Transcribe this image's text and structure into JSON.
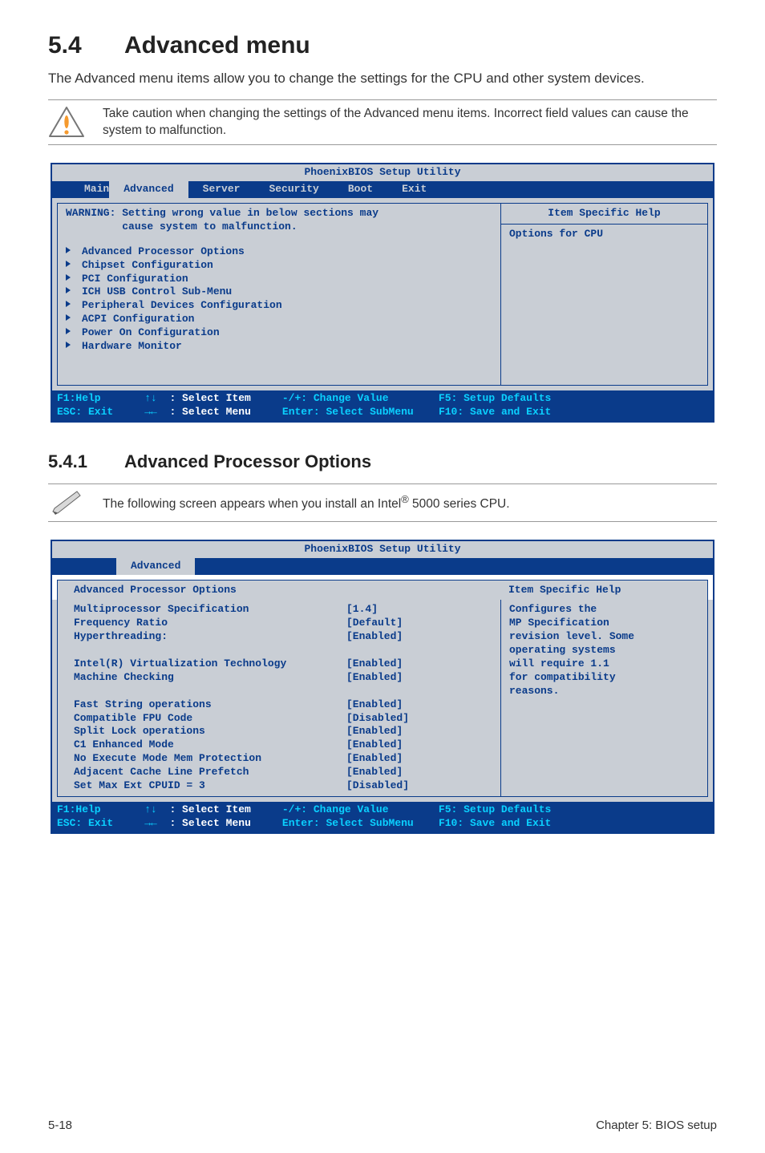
{
  "heading": {
    "num": "5.4",
    "title": "Advanced menu"
  },
  "intro": "The Advanced menu items allow you to change the settings for the CPU and other system devices.",
  "caution": "Take caution when changing the settings of the Advanced menu items. Incorrect field values can cause the system to malfunction.",
  "subheading": {
    "num": "5.4.1",
    "title": "Advanced Processor Options"
  },
  "note": {
    "pre": "The following screen appears when you install an Intel",
    "sup": "®",
    "post": " 5000 series CPU."
  },
  "bios1": {
    "utility_title": "PhoenixBIOS Setup Utility",
    "tabs": [
      "Main",
      "Advanced",
      "Server",
      "Security",
      "Boot",
      "Exit"
    ],
    "active_tab": "Advanced",
    "warning_l1": "WARNING: Setting wrong value in below sections may",
    "warning_l2": "         cause system to malfunction.",
    "menu": [
      "Advanced Processor Options",
      "Chipset Configuration",
      "PCI Configuration",
      "ICH USB Control Sub-Menu",
      "Peripheral Devices Configuration",
      "ACPI Configuration",
      "Power On Configuration",
      "Hardware Monitor"
    ],
    "help_title": "Item Specific Help",
    "help_body": "Options for CPU"
  },
  "bios2": {
    "utility_title": "PhoenixBIOS Setup Utility",
    "tab": "Advanced",
    "panel_title": "Advanced Processor Options",
    "settings": [
      {
        "label": "Multiprocessor Specification",
        "value": "[1.4]"
      },
      {
        "label": "Frequency Ratio",
        "value": "[Default]"
      },
      {
        "label": "Hyperthreading:",
        "value": "[Enabled]"
      },
      {
        "label": "",
        "value": ""
      },
      {
        "label": "Intel(R) Virtualization Technology",
        "value": "[Enabled]"
      },
      {
        "label": "Machine Checking",
        "value": "[Enabled]"
      },
      {
        "label": "",
        "value": ""
      },
      {
        "label": "Fast String operations",
        "value": "[Enabled]"
      },
      {
        "label": "Compatible FPU Code",
        "value": "[Disabled]"
      },
      {
        "label": "Split Lock operations",
        "value": "[Enabled]"
      },
      {
        "label": "C1 Enhanced Mode",
        "value": "[Enabled]"
      },
      {
        "label": "No Execute Mode Mem Protection",
        "value": "[Enabled]"
      },
      {
        "label": "Adjacent Cache Line Prefetch",
        "value": "[Enabled]"
      },
      {
        "label": "Set Max Ext CPUID = 3",
        "value": "[Disabled]"
      }
    ],
    "help_title": "Item Specific Help",
    "help_body": "Configures the\nMP Specification\nrevision level. Some\noperating systems\nwill require 1.1\nfor compatibility\nreasons."
  },
  "keybar": {
    "f1": "F1:Help",
    "esc": "ESC: Exit",
    "ud": "↑↓",
    "lr": "→←",
    "sel_item": ": Select Item",
    "sel_menu": ": Select Menu",
    "change": "-/+: Change Value",
    "enter": "Enter: Select SubMenu",
    "f5": "F5: Setup Defaults",
    "f10": "F10: Save and Exit"
  },
  "footer": {
    "left": "5-18",
    "right": "Chapter 5: BIOS setup"
  }
}
